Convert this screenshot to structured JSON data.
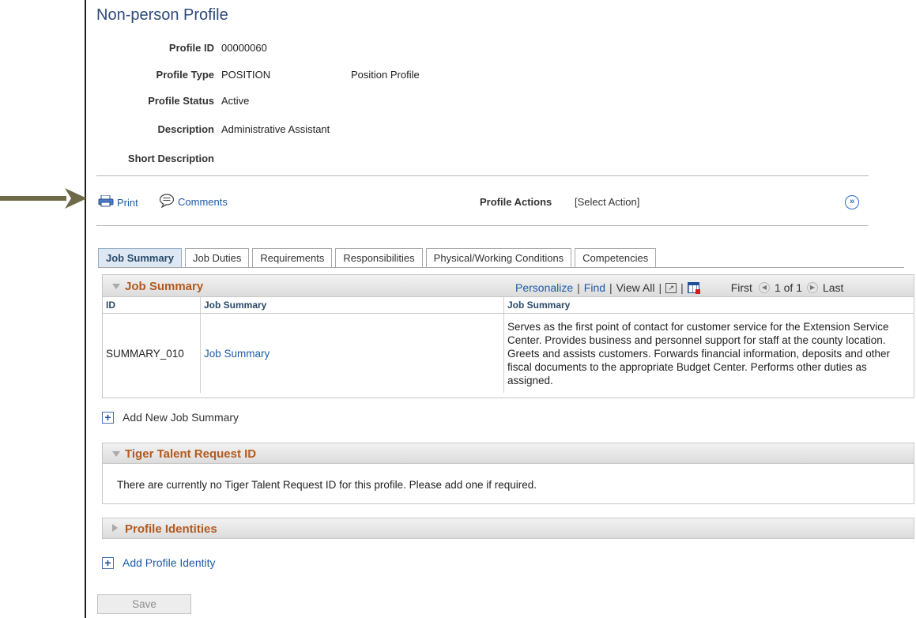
{
  "page": {
    "title": "Non-person Profile"
  },
  "profile": {
    "id_label": "Profile ID",
    "id_value": "00000060",
    "type_label": "Profile Type",
    "type_value": "POSITION",
    "type_desc": "Position Profile",
    "status_label": "Profile Status",
    "status_value": "Active",
    "description_label": "Description",
    "description_value": "Administrative Assistant",
    "short_description_label": "Short Description"
  },
  "toolbar": {
    "print_label": "Print",
    "comments_label": "Comments",
    "profile_actions_label": "Profile Actions",
    "profile_actions_value": "[Select Action]"
  },
  "tabs": [
    {
      "label": "Job Summary",
      "active": true
    },
    {
      "label": "Job Duties"
    },
    {
      "label": "Requirements"
    },
    {
      "label": "Responsibilities"
    },
    {
      "label": "Physical/Working Conditions"
    },
    {
      "label": "Competencies"
    }
  ],
  "job_summary_grid": {
    "title": "Job Summary",
    "nav": {
      "personalize": "Personalize",
      "find": "Find",
      "view_all": "View All",
      "first": "First",
      "count": "1 of 1",
      "last": "Last"
    },
    "columns": [
      "ID",
      "Job Summary",
      "Job Summary"
    ],
    "rows": [
      {
        "id": "SUMMARY_010",
        "name": "Job Summary",
        "text": "Serves as the first point of contact for customer service for the Extension Service Center. Provides business and personnel support for staff at the county location. Greets and assists customers. Forwards financial information, deposits and other fiscal documents to the appropriate Budget Center. Performs other duties as assigned."
      }
    ],
    "add_label": "Add New Job Summary"
  },
  "tiger_talent": {
    "title": "Tiger Talent Request ID",
    "message": "There are currently no Tiger Talent Request ID for this profile.  Please add one if required."
  },
  "profile_identities": {
    "title": "Profile Identities",
    "add_label": "Add Profile Identity"
  },
  "save_label": "Save",
  "colors": {
    "link": "#1e5aa8",
    "section_title": "#b35a1f",
    "page_title": "#2c4a7a"
  }
}
